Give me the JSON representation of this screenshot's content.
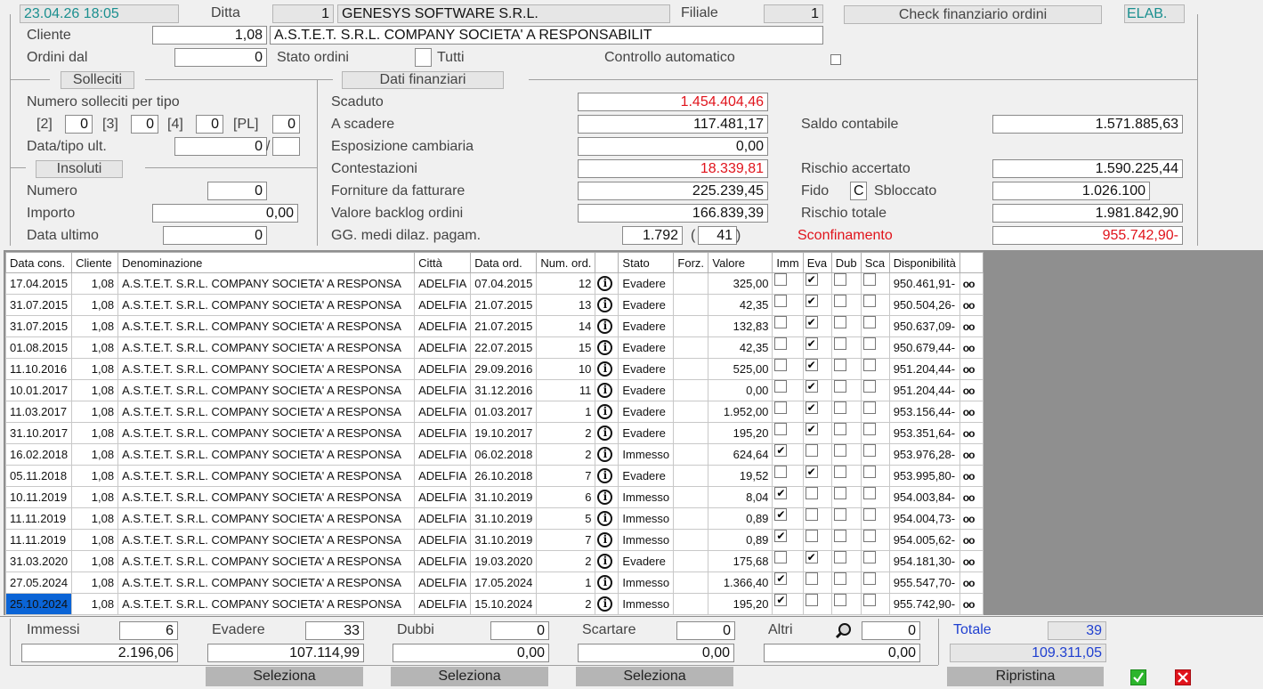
{
  "header": {
    "datetime": "23.04.26 18:05",
    "ditta_label": "Ditta",
    "ditta_code": "1",
    "ditta_name": "GENESYS SOFTWARE S.R.L.",
    "filiale_label": "Filiale",
    "filiale_code": "1",
    "check_button": "Check finanziario ordini",
    "elab_label": "ELAB."
  },
  "cliente": {
    "label": "Cliente",
    "code": "1,08",
    "name": "A.S.T.E.T. S.R.L. COMPANY SOCIETA' A RESPONSABILIT"
  },
  "ordini": {
    "dal_label": "Ordini dal",
    "dal_value": "0",
    "stato_label": "Stato ordini",
    "tutti_label": "Tutti",
    "controllo_label": "Controllo automatico"
  },
  "solleciti": {
    "title": "Solleciti",
    "numero_label": "Numero solleciti per tipo",
    "t2_label": "[2]",
    "t2_value": "0",
    "t3_label": "[3]",
    "t3_value": "0",
    "t4_label": "[4]",
    "t4_value": "0",
    "pl_label": "[PL]",
    "pl_value": "0",
    "data_tipo_label": "Data/tipo ult.",
    "data_tipo_value": "0",
    "slash": "/"
  },
  "insoluti": {
    "title": "Insoluti",
    "numero_label": "Numero",
    "numero_value": "0",
    "importo_label": "Importo",
    "importo_value": "0,00",
    "data_label": "Data ultimo",
    "data_value": "0"
  },
  "finanziari": {
    "title": "Dati finanziari",
    "scaduto_label": "Scaduto",
    "scaduto_value": "1.454.404,46",
    "ascadere_label": "A scadere",
    "ascadere_value": "117.481,17",
    "esposizione_label": "Esposizione cambiaria",
    "esposizione_value": "0,00",
    "contestazioni_label": "Contestazioni",
    "contestazioni_value": "18.339,81",
    "forniture_label": "Forniture da fatturare",
    "forniture_value": "225.239,45",
    "backlog_label": "Valore backlog ordini",
    "backlog_value": "166.839,39",
    "gg_label": "GG. medi dilaz. pagam.",
    "gg_value": "1.792",
    "gg_paren_open": "(",
    "gg_paren_value": "41",
    "gg_paren_close": ")",
    "saldo_label": "Saldo contabile",
    "saldo_value": "1.571.885,63",
    "rischio_acc_label": "Rischio accertato",
    "rischio_acc_value": "1.590.225,44",
    "fido_label": "Fido",
    "fido_flag": "C",
    "sbloccato_label": "Sbloccato",
    "fido_value": "1.026.100",
    "rischio_tot_label": "Rischio totale",
    "rischio_tot_value": "1.981.842,90",
    "sconf_label": "Sconfinamento",
    "sconf_value": "955.742,90-"
  },
  "table": {
    "columns": [
      "Data cons.",
      "Cliente",
      "Denominazione",
      "Città",
      "Data ord.",
      "Num. ord.",
      "",
      "Stato",
      "Forz.",
      "Valore",
      "Imm",
      "Eva",
      "Dub",
      "Sca",
      "Disponibilità",
      ""
    ],
    "rows": [
      {
        "data_cons": "17.04.2015",
        "cliente": "1,08",
        "den": "A.S.T.E.T. S.R.L. COMPANY SOCIETA' A RESPONSA",
        "citta": "ADELFIA",
        "data_ord": "07.04.2015",
        "num": "12",
        "stato": "Evadere",
        "forz": "",
        "valore": "325,00",
        "imm": false,
        "eva": true,
        "disp": "950.461,91-"
      },
      {
        "data_cons": "31.07.2015",
        "cliente": "1,08",
        "den": "A.S.T.E.T. S.R.L. COMPANY SOCIETA' A RESPONSA",
        "citta": "ADELFIA",
        "data_ord": "21.07.2015",
        "num": "13",
        "stato": "Evadere",
        "forz": "",
        "valore": "42,35",
        "imm": false,
        "eva": true,
        "disp": "950.504,26-"
      },
      {
        "data_cons": "31.07.2015",
        "cliente": "1,08",
        "den": "A.S.T.E.T. S.R.L. COMPANY SOCIETA' A RESPONSA",
        "citta": "ADELFIA",
        "data_ord": "21.07.2015",
        "num": "14",
        "stato": "Evadere",
        "forz": "",
        "valore": "132,83",
        "imm": false,
        "eva": true,
        "disp": "950.637,09-"
      },
      {
        "data_cons": "01.08.2015",
        "cliente": "1,08",
        "den": "A.S.T.E.T. S.R.L. COMPANY SOCIETA' A RESPONSA",
        "citta": "ADELFIA",
        "data_ord": "22.07.2015",
        "num": "15",
        "stato": "Evadere",
        "forz": "",
        "valore": "42,35",
        "imm": false,
        "eva": true,
        "disp": "950.679,44-"
      },
      {
        "data_cons": "11.10.2016",
        "cliente": "1,08",
        "den": "A.S.T.E.T. S.R.L. COMPANY SOCIETA' A RESPONSA",
        "citta": "ADELFIA",
        "data_ord": "29.09.2016",
        "num": "10",
        "stato": "Evadere",
        "forz": "",
        "valore": "525,00",
        "imm": false,
        "eva": true,
        "disp": "951.204,44-"
      },
      {
        "data_cons": "10.01.2017",
        "cliente": "1,08",
        "den": "A.S.T.E.T. S.R.L. COMPANY SOCIETA' A RESPONSA",
        "citta": "ADELFIA",
        "data_ord": "31.12.2016",
        "num": "11",
        "stato": "Evadere",
        "forz": "",
        "valore": "0,00",
        "imm": false,
        "eva": true,
        "disp": "951.204,44-"
      },
      {
        "data_cons": "11.03.2017",
        "cliente": "1,08",
        "den": "A.S.T.E.T. S.R.L. COMPANY SOCIETA' A RESPONSA",
        "citta": "ADELFIA",
        "data_ord": "01.03.2017",
        "num": "1",
        "stato": "Evadere",
        "forz": "",
        "valore": "1.952,00",
        "imm": false,
        "eva": true,
        "disp": "953.156,44-"
      },
      {
        "data_cons": "31.10.2017",
        "cliente": "1,08",
        "den": "A.S.T.E.T. S.R.L. COMPANY SOCIETA' A RESPONSA",
        "citta": "ADELFIA",
        "data_ord": "19.10.2017",
        "num": "2",
        "stato": "Evadere",
        "forz": "",
        "valore": "195,20",
        "imm": false,
        "eva": true,
        "disp": "953.351,64-"
      },
      {
        "data_cons": "16.02.2018",
        "cliente": "1,08",
        "den": "A.S.T.E.T. S.R.L. COMPANY SOCIETA' A RESPONSA",
        "citta": "ADELFIA",
        "data_ord": "06.02.2018",
        "num": "2",
        "stato": "Immesso",
        "forz": "",
        "valore": "624,64",
        "imm": true,
        "eva": false,
        "disp": "953.976,28-"
      },
      {
        "data_cons": "05.11.2018",
        "cliente": "1,08",
        "den": "A.S.T.E.T. S.R.L. COMPANY SOCIETA' A RESPONSA",
        "citta": "ADELFIA",
        "data_ord": "26.10.2018",
        "num": "7",
        "stato": "Evadere",
        "forz": "",
        "valore": "19,52",
        "imm": false,
        "eva": true,
        "disp": "953.995,80-"
      },
      {
        "data_cons": "10.11.2019",
        "cliente": "1,08",
        "den": "A.S.T.E.T. S.R.L. COMPANY SOCIETA' A RESPONSA",
        "citta": "ADELFIA",
        "data_ord": "31.10.2019",
        "num": "6",
        "stato": "Immesso",
        "forz": "",
        "valore": "8,04",
        "imm": true,
        "eva": false,
        "disp": "954.003,84-"
      },
      {
        "data_cons": "11.11.2019",
        "cliente": "1,08",
        "den": "A.S.T.E.T. S.R.L. COMPANY SOCIETA' A RESPONSA",
        "citta": "ADELFIA",
        "data_ord": "31.10.2019",
        "num": "5",
        "stato": "Immesso",
        "forz": "",
        "valore": "0,89",
        "imm": true,
        "eva": false,
        "disp": "954.004,73-"
      },
      {
        "data_cons": "11.11.2019",
        "cliente": "1,08",
        "den": "A.S.T.E.T. S.R.L. COMPANY SOCIETA' A RESPONSA",
        "citta": "ADELFIA",
        "data_ord": "31.10.2019",
        "num": "7",
        "stato": "Immesso",
        "forz": "",
        "valore": "0,89",
        "imm": true,
        "eva": false,
        "disp": "954.005,62-"
      },
      {
        "data_cons": "31.03.2020",
        "cliente": "1,08",
        "den": "A.S.T.E.T. S.R.L. COMPANY SOCIETA' A RESPONSA",
        "citta": "ADELFIA",
        "data_ord": "19.03.2020",
        "num": "2",
        "stato": "Evadere",
        "forz": "",
        "valore": "175,68",
        "imm": false,
        "eva": true,
        "disp": "954.181,30-"
      },
      {
        "data_cons": "27.05.2024",
        "cliente": "1,08",
        "den": "A.S.T.E.T. S.R.L. COMPANY SOCIETA' A RESPONSA",
        "citta": "ADELFIA",
        "data_ord": "17.05.2024",
        "num": "1",
        "stato": "Immesso",
        "forz": "",
        "valore": "1.366,40",
        "imm": true,
        "eva": false,
        "disp": "955.547,70-"
      },
      {
        "data_cons": "25.10.2024",
        "cliente": "1,08",
        "den": "A.S.T.E.T. S.R.L. COMPANY SOCIETA' A RESPONSA",
        "citta": "ADELFIA",
        "data_ord": "15.10.2024",
        "num": "2",
        "stato": "Immesso",
        "forz": "",
        "valore": "195,20",
        "imm": true,
        "eva": false,
        "disp": "955.742,90-",
        "selected": true
      }
    ]
  },
  "footer": {
    "immessi_label": "Immessi",
    "immessi_count": "6",
    "immessi_total": "2.196,06",
    "evadere_label": "Evadere",
    "evadere_count": "33",
    "evadere_total": "107.114,99",
    "dubbi_label": "Dubbi",
    "dubbi_count": "0",
    "dubbi_total": "0,00",
    "scartare_label": "Scartare",
    "scartare_count": "0",
    "scartare_total": "0,00",
    "altri_label": "Altri",
    "altri_count": "0",
    "altri_total": "0,00",
    "totale_label": "Totale",
    "totale_count": "39",
    "totale_total": "109.311,05",
    "seleziona": "Seleziona",
    "ripristina": "Ripristina"
  },
  "colors": {
    "accent_teal": "#1a8f8f",
    "negative_red": "#e0141c",
    "total_blue": "#1f3fd0",
    "selection_blue": "#0a64d6",
    "confirm_green": "#2db52d",
    "cancel_red": "#e0141c"
  }
}
